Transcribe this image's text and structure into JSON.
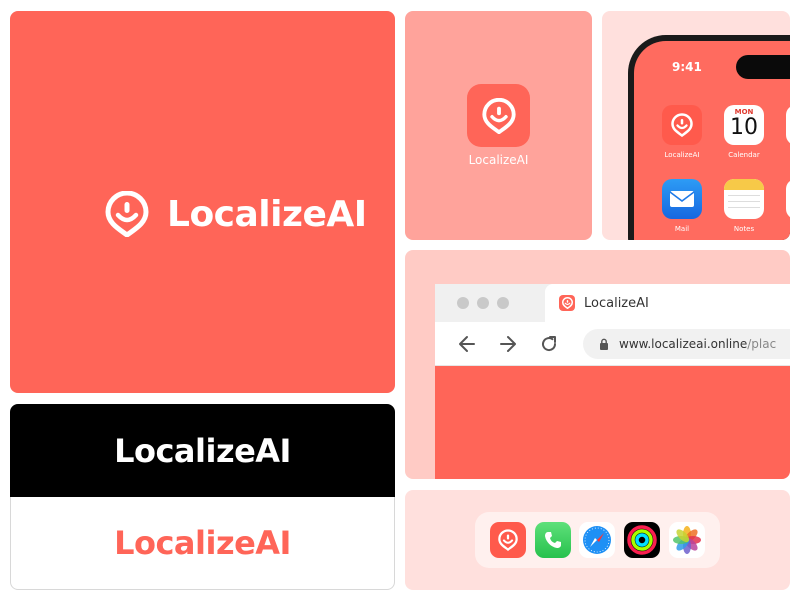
{
  "brand": {
    "name": "LocalizeAI",
    "colors": {
      "primary": "#ff6558",
      "light": "#ffa39b",
      "pale": "#ffe0dd",
      "dark": "#000000",
      "white": "#ffffff"
    }
  },
  "hero": {
    "wordmark": "LocalizeAI",
    "icon": "location-pin-face-icon"
  },
  "app_icon_card": {
    "label": "LocalizeAI",
    "icon": "location-pin-face-icon"
  },
  "phone": {
    "time": "9:41",
    "apps": [
      {
        "label": "LocalizeAI",
        "icon": "location-pin-face-icon"
      },
      {
        "label": "Calendar",
        "icon": "calendar-icon",
        "day": "MON",
        "date": "10"
      },
      {
        "label": "Mail",
        "icon": "mail-icon"
      },
      {
        "label": "Notes",
        "icon": "notes-icon"
      }
    ]
  },
  "browser": {
    "tab_title": "LocalizeAI",
    "url_domain": "www.localizeai.online",
    "url_path": " /plac",
    "icons": [
      "back-arrow-icon",
      "forward-arrow-icon",
      "reload-icon",
      "lock-icon"
    ]
  },
  "wordmark_dark": "LocalizeAI",
  "wordmark_light": "LocalizeAI",
  "dock": {
    "apps": [
      "localizeai-icon",
      "phone-icon",
      "safari-icon",
      "activity-icon",
      "photos-icon"
    ]
  }
}
